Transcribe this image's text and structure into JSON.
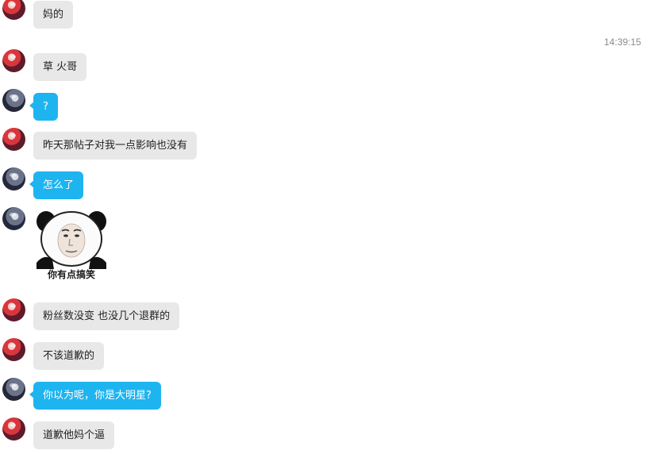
{
  "timestamp": "14:39:15",
  "messages": [
    {
      "text": "妈的"
    },
    {
      "text": "草 火哥"
    },
    {
      "text": "?"
    },
    {
      "text": "昨天那帖子对我一点影响也没有"
    },
    {
      "text": "怎么了"
    },
    {
      "sticker_caption": "你有点搞笑"
    },
    {
      "text": "粉丝数没变 也没几个退群的"
    },
    {
      "text": "不该道歉的"
    },
    {
      "text": "你以为呢，你是大明星?"
    },
    {
      "text": "道歉他妈个逼"
    }
  ],
  "colors": {
    "received_bubble": "#e8e8e8",
    "sent_bubble": "#1eb4f0",
    "background": "#ffffff"
  },
  "icons": {
    "avatar_a": "red-hair-anime-avatar",
    "avatar_b": "dark-anime-avatar",
    "sticker": "panda-face-sticker"
  }
}
